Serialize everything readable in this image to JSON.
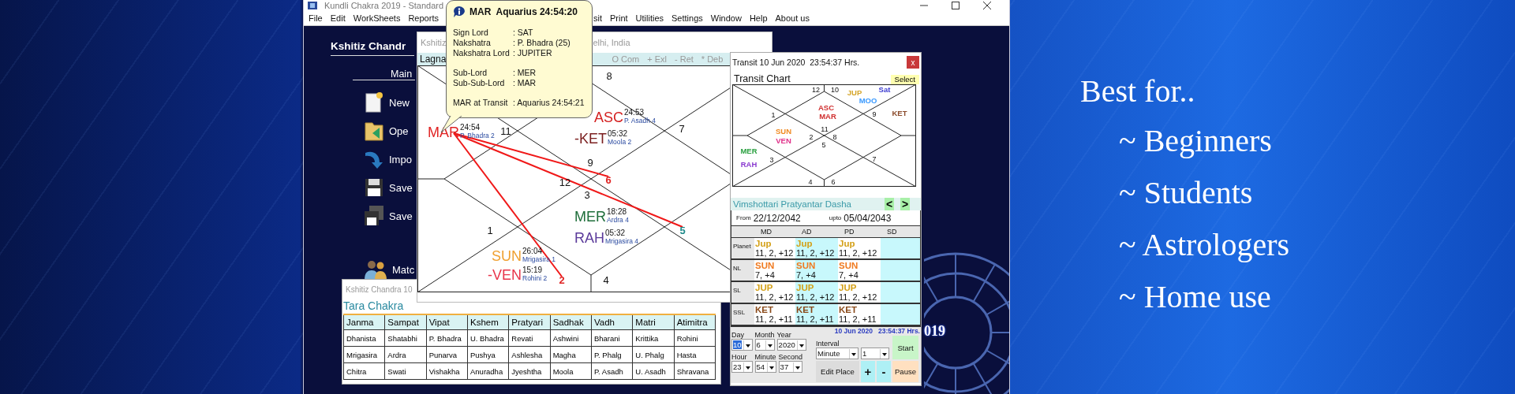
{
  "app_window": {
    "title": "Kundli Chakra 2019 - Standard"
  },
  "menu": [
    {
      "label": "File"
    },
    {
      "label": "Edit"
    },
    {
      "label": "WorkSheets"
    },
    {
      "label": "Reports"
    },
    {
      "label": "sit"
    },
    {
      "label": "Print"
    },
    {
      "label": "Utilities"
    },
    {
      "label": "Settings"
    },
    {
      "label": "Window"
    },
    {
      "label": "Help"
    },
    {
      "label": "About us"
    }
  ],
  "main_panel": {
    "heading": "Kshitiz Chandr",
    "section": "Main",
    "items": [
      {
        "kind": "new",
        "label": "New"
      },
      {
        "kind": "open",
        "label": "Ope"
      },
      {
        "kind": "import",
        "label": "Impo"
      },
      {
        "kind": "save",
        "label": "Save"
      },
      {
        "kind": "save_as",
        "label": "Save"
      },
      {
        "kind": "match",
        "label": "Matc"
      }
    ]
  },
  "lagna_window": {
    "title_start": "Kshitiz",
    "title_end": "elhi, India",
    "chart_label": "Lagna",
    "legend": [
      "O Com",
      "+ Exl",
      "- Ret",
      "* Deb"
    ],
    "houses": [
      {
        "number": "8",
        "color": "#111111"
      },
      {
        "number": "11",
        "color": "#111111"
      },
      {
        "number": "7",
        "color": "#111111"
      },
      {
        "number": "9",
        "color": "#111111"
      },
      {
        "number": "12",
        "color": "#111111"
      },
      {
        "number": "6",
        "color": "#e02424"
      },
      {
        "number": "3",
        "color": "#111111"
      },
      {
        "number": "1",
        "color": "#111111"
      },
      {
        "number": "5",
        "color": "#1f8a8a"
      },
      {
        "number": "2",
        "color": "#e02424"
      },
      {
        "number": "4",
        "color": "#111111"
      }
    ],
    "planets": [
      {
        "name": "MAR",
        "degree": "24:54",
        "nakshatra": "P. Bhadra 2",
        "color": "#e02424"
      },
      {
        "name": "ASC",
        "degree": "24:53",
        "nakshatra": "P. Asadh 4",
        "color": "#d42020"
      },
      {
        "name": "-KET",
        "degree": "05:32",
        "nakshatra": "Moola 2",
        "color": "#7a1e1e"
      },
      {
        "name": "MER",
        "degree": "18:28",
        "nakshatra": "Ardra 4",
        "color": "#1e6e3a"
      },
      {
        "name": "RAH",
        "degree": "05:32",
        "nakshatra": "Mrigasira 4",
        "color": "#5a3a9a"
      },
      {
        "name": "SUN",
        "degree": "26:04",
        "nakshatra": "Mrigasira 1",
        "color": "#f0a030"
      },
      {
        "name": "-VEN",
        "degree": "15:19",
        "nakshatra": "Rohini 2",
        "color": "#e8344a"
      }
    ]
  },
  "tooltip": {
    "title": "MAR  Aquarius 24:54:20",
    "groups": [
      [
        {
          "label": "Sign Lord",
          "value": ": SAT"
        },
        {
          "label": "Nakshatra",
          "value": ": P. Bhadra (25)"
        },
        {
          "label": "Nakshatra Lord",
          "value": ": JUPITER"
        }
      ],
      [
        {
          "label": "Sub-Lord",
          "value": ": MER"
        },
        {
          "label": "Sub-Sub-Lord",
          "value": ": MAR"
        }
      ],
      [
        {
          "label": "MAR at Transit",
          "value": ": Aquarius 24:54:21"
        }
      ]
    ]
  },
  "tara_chakra_window": {
    "title": "Kshitiz Chandra 10",
    "heading": "Tara Chakra",
    "columns": [
      "Janma",
      "Sampat",
      "Vipat",
      "Kshem",
      "Pratyari",
      "Sadhak",
      "Vadh",
      "Matri",
      "Atimitra"
    ],
    "rows": [
      [
        "Dhanista",
        "Shatabhi",
        "P. Bhadra",
        "U. Bhadra",
        "Revati",
        "Ashwini",
        "Bharani",
        "Krittika",
        "Rohini"
      ],
      [
        "Mrigasira",
        "Ardra",
        "Punarva",
        "Pushya",
        "Ashlesha",
        "Magha",
        "P. Phalg",
        "U. Phalg",
        "Hasta"
      ],
      [
        "Chitra",
        "Swati",
        "Vishakha",
        "Anuradha",
        "Jyeshtha",
        "Moola",
        "P. Asadh",
        "U. Asadh",
        "Shravana"
      ]
    ]
  },
  "transit_window": {
    "title": "Transit 10 Jun 2020  23:54:37 Hrs.",
    "close": "x",
    "chart_label": "Transit Chart",
    "select_button": "Select",
    "houses": [
      {
        "number": "12"
      },
      {
        "number": "10"
      },
      {
        "number": "1"
      },
      {
        "number": "9"
      },
      {
        "number": "11"
      },
      {
        "number": "2"
      },
      {
        "number": "8"
      },
      {
        "number": "5"
      },
      {
        "number": "3"
      },
      {
        "number": "7"
      },
      {
        "number": "4"
      },
      {
        "number": "6"
      }
    ],
    "planets": [
      {
        "name": "JUP",
        "color": "#d4a52a"
      },
      {
        "name": "Sat",
        "color": "#3a3ad0"
      },
      {
        "name": "MOO",
        "color": "#3a9aff"
      },
      {
        "name": "ASC",
        "color": "#d03030"
      },
      {
        "name": "MAR",
        "color": "#d03030"
      },
      {
        "name": "KET",
        "color": "#8a4a2a"
      },
      {
        "name": "SUN",
        "color": "#f08a20"
      },
      {
        "name": "VEN",
        "color": "#e0308a"
      },
      {
        "name": "MER",
        "color": "#2aa040"
      },
      {
        "name": "RAH",
        "color": "#8a3ad0"
      }
    ],
    "dasha": {
      "title": "Vimshottari Pratyantar Dasha",
      "prev": "<",
      "next": ">",
      "from_label": "From",
      "from": "22/12/2042",
      "upto_label": "upto",
      "upto": "05/04/2043",
      "columns": [
        "MD",
        "AD",
        "PD",
        "SD"
      ],
      "rows": [
        {
          "label": "Planet",
          "cells": [
            {
              "planet": "Jup",
              "color": "#d4a017",
              "values": "11, 2, +12"
            },
            {
              "planet": "Jup",
              "color": "#d4a017",
              "values": "11, 2, +12"
            },
            {
              "planet": "Jup",
              "color": "#d4a017",
              "values": "11, 2, +12"
            }
          ]
        },
        {
          "label": "NL",
          "cells": [
            {
              "planet": "SUN",
              "color": "#f07a20",
              "values": "7, +4"
            },
            {
              "planet": "SUN",
              "color": "#f07a20",
              "values": "7, +4"
            },
            {
              "planet": "SUN",
              "color": "#f07a20",
              "values": "7, +4"
            }
          ]
        },
        {
          "label": "SL",
          "cells": [
            {
              "planet": "JUP",
              "color": "#d4a017",
              "values": "11, 2, +12"
            },
            {
              "planet": "JUP",
              "color": "#d4a017",
              "values": "11, 2, +12"
            },
            {
              "planet": "JUP",
              "color": "#d4a017",
              "values": "11, 2, +12"
            }
          ]
        },
        {
          "label": "SSL",
          "cells": [
            {
              "planet": "KET",
              "color": "#8a4a1a",
              "values": "11, 2, +11"
            },
            {
              "planet": "KET",
              "color": "#8a4a1a",
              "values": "11, 2, +11"
            },
            {
              "planet": "KET",
              "color": "#8a4a1a",
              "values": "11, 2, +11"
            }
          ]
        }
      ]
    },
    "controls": {
      "clock": "10 Jun 2020   23:54:37 Hrs.",
      "date_fields": [
        {
          "label": "Day",
          "value": "10",
          "highlighted": true
        },
        {
          "label": "Month",
          "value": "6",
          "highlighted": false
        },
        {
          "label": "Year",
          "value": "2020",
          "highlighted": false
        }
      ],
      "time_fields": [
        {
          "label": "Hour",
          "value": "23",
          "highlighted": false
        },
        {
          "label": "Minute",
          "value": "54",
          "highlighted": false
        },
        {
          "label": "Second",
          "value": "37",
          "highlighted": false
        }
      ],
      "interval": {
        "label": "Interval",
        "value": "Minute"
      },
      "step": {
        "value": "1"
      },
      "buttons": {
        "start": "Start",
        "edit_place": "Edit Place",
        "plus": "+",
        "minus": "-",
        "pause": "Pause"
      }
    }
  },
  "background_text": "019",
  "promo": {
    "heading": "Best for..",
    "items": [
      "~ Beginners",
      "~ Students",
      "~ Astrologers",
      "~ Home use"
    ]
  }
}
